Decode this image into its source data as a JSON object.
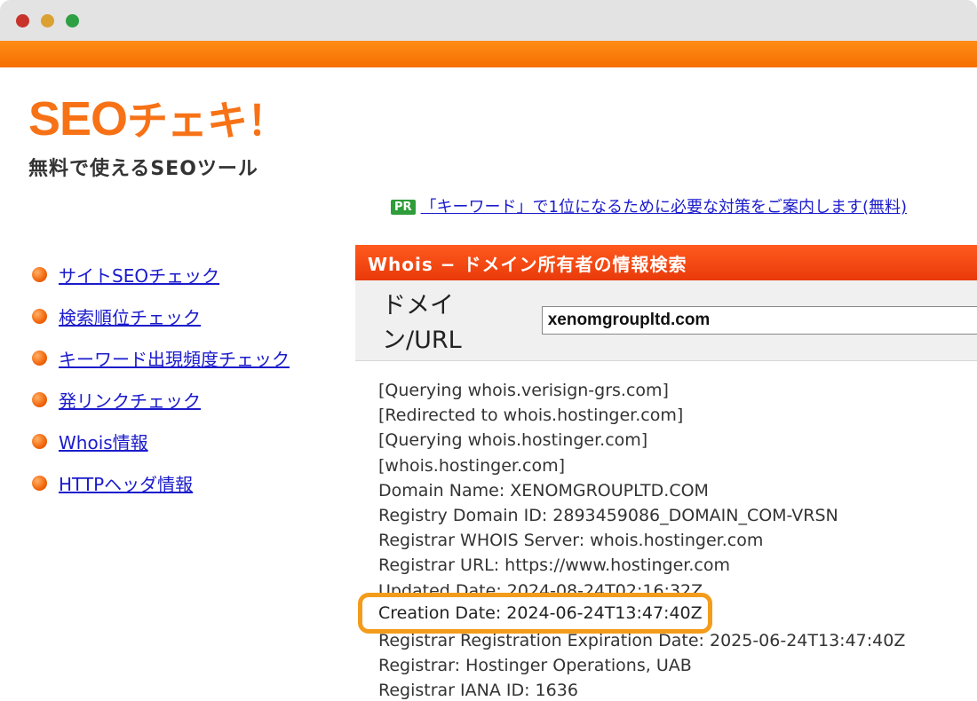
{
  "window": {
    "controls": [
      "close",
      "minimize",
      "maximize"
    ]
  },
  "header": {
    "logo_text": "SEO",
    "logo_kana": "チェキ！",
    "tagline": "無料で使えるSEOツール",
    "pr_badge": "PR",
    "pr_link": "「キーワード」で1位になるために必要な対策をご案内します(無料)"
  },
  "sidebar": {
    "items": [
      {
        "label": "サイトSEOチェック"
      },
      {
        "label": "検索順位チェック"
      },
      {
        "label": "キーワード出現頻度チェック"
      },
      {
        "label": "発リンクチェック"
      },
      {
        "label": "Whois情報"
      },
      {
        "label": "HTTPヘッダ情報"
      }
    ]
  },
  "panel": {
    "title": "Whois − ドメイン所有者の情報検索",
    "search_label": "ドメイン/URL",
    "search_value": "xenomgroupltd.com"
  },
  "results": {
    "lines": [
      "[Querying whois.verisign-grs.com]",
      "[Redirected to whois.hostinger.com]",
      "[Querying whois.hostinger.com]",
      "[whois.hostinger.com]",
      "Domain Name: XENOMGROUPLTD.COM",
      "Registry Domain ID: 2893459086_DOMAIN_COM-VRSN",
      "Registrar WHOIS Server: whois.hostinger.com",
      "Registrar URL: https://www.hostinger.com",
      "Updated Date: 2024-08-24T02:16:32Z",
      "",
      "Registrar Registration Expiration Date: 2025-06-24T13:47:40Z",
      "Registrar: Hostinger Operations, UAB",
      "Registrar IANA ID: 1636"
    ],
    "highlight": "Creation Date: 2024-06-24T13:47:40Z"
  },
  "colors": {
    "accent_orange": "#f77216",
    "header_red": "#e93a0a",
    "highlight_border": "#f39c1c",
    "link_blue": "#1b1bcc"
  }
}
